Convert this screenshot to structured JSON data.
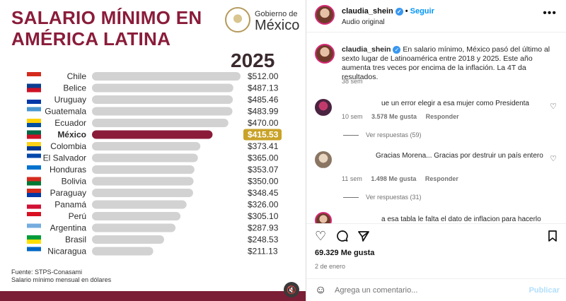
{
  "post_image": {
    "title_line1": "SALARIO MÍNIMO EN",
    "title_line2": "AMÉRICA LATINA",
    "gov_small": "Gobierno de",
    "gov_big": "México",
    "year": "2025",
    "source": "Fuente: STPS-Conasami",
    "note": "Salario mínimo mensual en dólares",
    "mute_icon": "speaker-muted-icon"
  },
  "chart_data": {
    "type": "bar",
    "orientation": "horizontal",
    "title": "SALARIO MÍNIMO EN AMÉRICA LATINA",
    "subtitle": "2025",
    "categories": [
      "Chile",
      "Belice",
      "Uruguay",
      "Guatemala",
      "Ecuador",
      "México",
      "Colombia",
      "El Salvador",
      "Honduras",
      "Bolivia",
      "Paraguay",
      "Panamá",
      "Perú",
      "Argentina",
      "Brasil",
      "Nicaragua"
    ],
    "values": [
      512.0,
      487.13,
      485.46,
      483.99,
      470.0,
      415.53,
      373.41,
      365.0,
      353.07,
      350.0,
      348.45,
      326.0,
      305.1,
      287.93,
      248.53,
      211.13
    ],
    "labels": [
      "$512.00",
      "$487.13",
      "$485.46",
      "$483.99",
      "$470.00",
      "$415.53",
      "$373.41",
      "$365.00",
      "$353.07",
      "$350.00",
      "$348.45",
      "$326.00",
      "$305.10",
      "$287.93",
      "$248.53",
      "$211.13"
    ],
    "highlight": "México",
    "xlim": [
      0,
      512
    ],
    "grid": false,
    "colors": {
      "bar": "#d2d2d2",
      "highlight_bar": "#8a1c3a",
      "highlight_label_bg": "#c9a227",
      "text": "#2b2b2b"
    },
    "flags": [
      [
        "#d52b1e",
        "#ffffff"
      ],
      [
        "#0b3d91",
        "#ce1126"
      ],
      [
        "#ffffff",
        "#0038a8"
      ],
      [
        "#4997d0",
        "#ffffff"
      ],
      [
        "#ffd100",
        "#034ea2"
      ],
      [
        "#006847",
        "#ce1126"
      ],
      [
        "#fcd116",
        "#003893"
      ],
      [
        "#0047ab",
        "#ffffff"
      ],
      [
        "#0073cf",
        "#ffffff"
      ],
      [
        "#d52b1e",
        "#007934"
      ],
      [
        "#d52b1e",
        "#0038a8"
      ],
      [
        "#ffffff",
        "#d21034"
      ],
      [
        "#d91023",
        "#ffffff"
      ],
      [
        "#74acdf",
        "#ffffff"
      ],
      [
        "#009c3b",
        "#ffdf00"
      ],
      [
        "#0067c6",
        "#ffffff"
      ]
    ]
  },
  "header": {
    "username": "claudia_shein",
    "verified_icon": "verified-badge-icon",
    "follow_label": "Seguir",
    "audio": "Audio original",
    "more_icon": "more-options-icon"
  },
  "caption": {
    "username": "claudia_shein",
    "text": "En salario mínimo, México pasó del último al sexto lugar de Latinoamérica entre 2018 y 2025. Este año aumenta tres veces por encima de la inflación. La 4T da resultados.",
    "time": "38 sem"
  },
  "comments": [
    {
      "text": "ue un error elegir a esa mujer como Presidenta",
      "time": "10 sem",
      "likes": "3.578 Me gusta",
      "reply": "Responder",
      "view_replies": "Ver respuestas (59)"
    },
    {
      "text": "Gracias Morena... Gracias por destruir un país entero",
      "time": "11 sem",
      "likes": "1.498 Me gusta",
      "reply": "Responder",
      "view_replies": "Ver respuestas (31)"
    },
    {
      "text": "a esa tabla le falta el dato de inflacion para hacerlo"
    }
  ],
  "actions": {
    "like_icon": "heart-icon",
    "comment_icon": "comment-icon",
    "share_icon": "share-icon",
    "save_icon": "bookmark-icon",
    "likes": "69.329 Me gusta",
    "date": "2 de enero"
  },
  "composer": {
    "emoji_icon": "emoji-icon",
    "placeholder": "Agrega un comentario...",
    "publish": "Publicar"
  }
}
